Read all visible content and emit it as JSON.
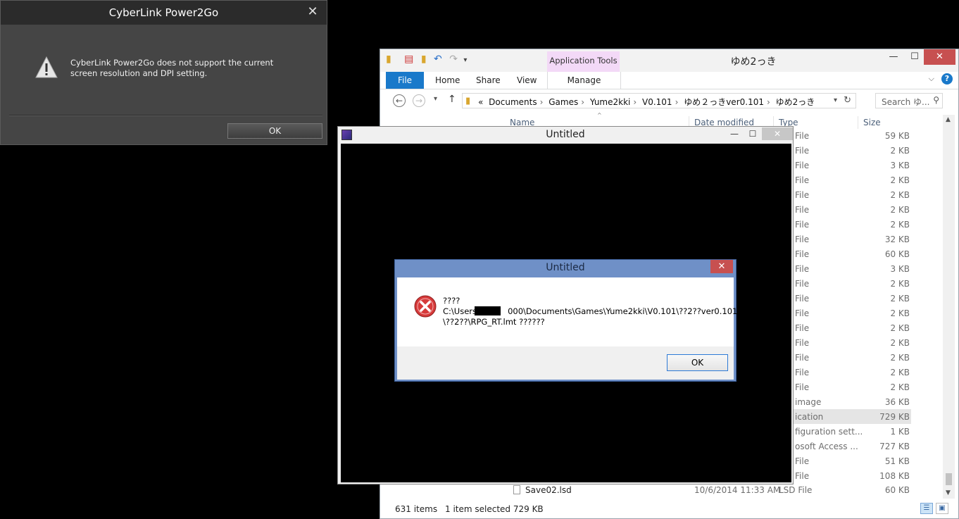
{
  "cyberlink": {
    "title": "CyberLink Power2Go",
    "close": "✕",
    "message": "CyberLink Power2Go does not support the current screen resolution and DPI setting.",
    "ok_label": "OK"
  },
  "explorer": {
    "app_tools": "Application Tools",
    "title": "ゆめ2っき",
    "tabs": {
      "file": "File",
      "home": "Home",
      "share": "Share",
      "view": "View",
      "manage": "Manage"
    },
    "controls": {
      "min": "—",
      "max": "☐",
      "close": "✕"
    },
    "breadcrumb": {
      "more": "«",
      "items": [
        "Documents",
        "Games",
        "Yume2kki",
        "V0.101",
        "ゆめ２っきver0.101",
        "ゆめ2っき"
      ]
    },
    "search_placeholder": "Search ゆ...",
    "columns": {
      "name": "Name",
      "date": "Date modified",
      "type": "Type",
      "size": "Size"
    },
    "rows": [
      {
        "type": "File",
        "size": "59 KB"
      },
      {
        "type": "File",
        "size": "2 KB"
      },
      {
        "type": "File",
        "size": "3 KB"
      },
      {
        "type": "File",
        "size": "2 KB"
      },
      {
        "type": "File",
        "size": "2 KB"
      },
      {
        "type": "File",
        "size": "2 KB"
      },
      {
        "type": "File",
        "size": "2 KB"
      },
      {
        "type": "File",
        "size": "32 KB"
      },
      {
        "type": "File",
        "size": "60 KB"
      },
      {
        "type": "File",
        "size": "3 KB"
      },
      {
        "type": "File",
        "size": "2 KB"
      },
      {
        "type": "File",
        "size": "2 KB"
      },
      {
        "type": "File",
        "size": "2 KB"
      },
      {
        "type": "File",
        "size": "2 KB"
      },
      {
        "type": "File",
        "size": "2 KB"
      },
      {
        "type": "File",
        "size": "2 KB"
      },
      {
        "type": "File",
        "size": "2 KB"
      },
      {
        "type": "File",
        "size": "2 KB"
      },
      {
        "type": "image",
        "size": "36 KB"
      },
      {
        "type": "ication",
        "size": "729 KB"
      },
      {
        "type": "figuration sett...",
        "size": "1 KB"
      },
      {
        "type": "osoft Access ...",
        "size": "727 KB"
      },
      {
        "type": "File",
        "size": "51 KB"
      },
      {
        "type": "File",
        "size": "108 KB"
      }
    ],
    "last_row": {
      "name": "Save02.lsd",
      "date": "10/6/2014 11:33 AM",
      "type": "LSD File",
      "size": "60 KB"
    },
    "status": {
      "items": "631 items",
      "selected": "1 item selected  729 KB"
    }
  },
  "rpg": {
    "title": "Untitled",
    "controls": {
      "min": "—",
      "max": "☐",
      "close": "✕"
    }
  },
  "error": {
    "title": "Untitled",
    "close": "✕",
    "message": "????\nC:\\Users\\           000\\Documents\\Games\\Yume2kki\\V0.101\\??2??ver0.101\n\\??2??\\RPG_RT.lmt ??????",
    "ok_label": "OK"
  },
  "colors": {
    "file_tab": "#1979ca",
    "app_tools": "#f3d9f7",
    "error_title": "#6f90c7",
    "close_red": "#c75050"
  }
}
